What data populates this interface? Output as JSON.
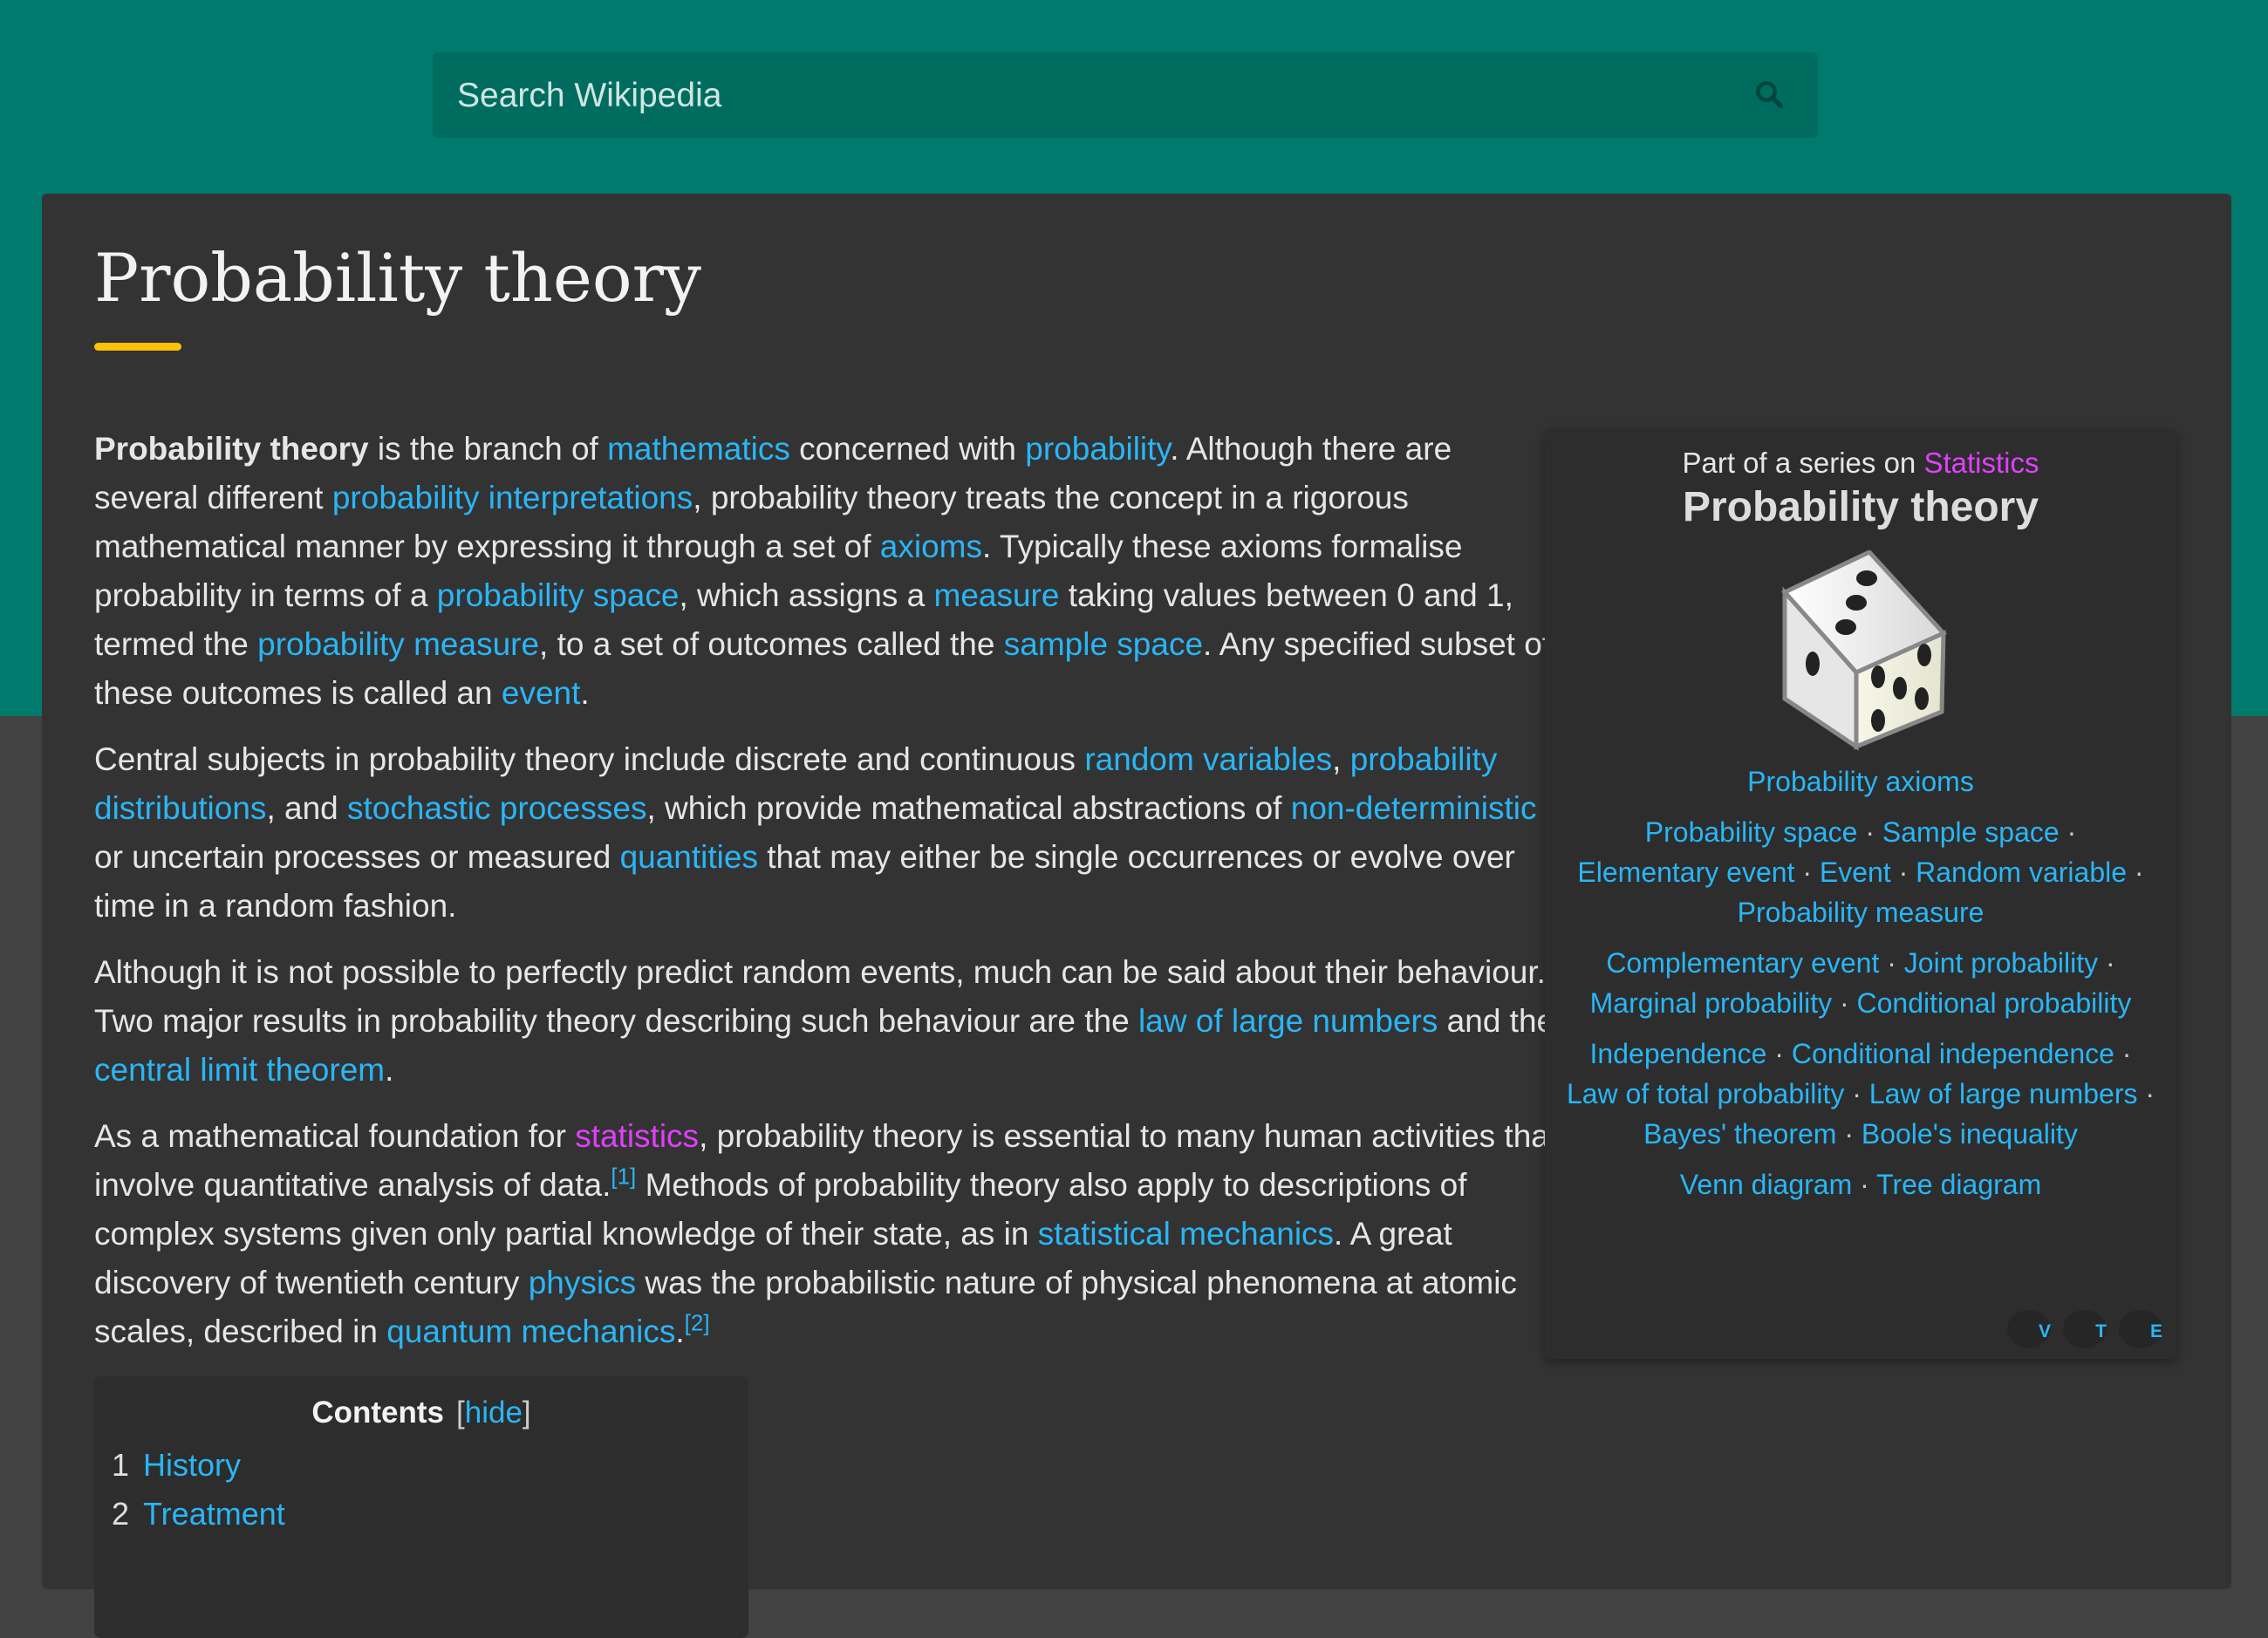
{
  "search": {
    "placeholder": "Search Wikipedia",
    "icon": "search-icon"
  },
  "article": {
    "title": "Probability theory",
    "accent_color": "#ffc107",
    "paragraphs": [
      [
        {
          "t": "Probability theory",
          "b": true
        },
        {
          "t": " is the branch of "
        },
        {
          "t": "mathematics",
          "l": 1
        },
        {
          "t": " concerned with "
        },
        {
          "t": "probability",
          "l": 1
        },
        {
          "t": ". Although there are several different "
        },
        {
          "t": "probability interpretations",
          "l": 1
        },
        {
          "t": ", probability theory treats the concept in a rigorous mathematical manner by expressing it through a set of "
        },
        {
          "t": "axioms",
          "l": 1
        },
        {
          "t": ". Typically these axioms formalise probability in terms of a "
        },
        {
          "t": "probability space",
          "l": 1
        },
        {
          "t": ", which assigns a "
        },
        {
          "t": "measure",
          "l": 1
        },
        {
          "t": " taking values between 0 and 1, termed the "
        },
        {
          "t": "probability measure",
          "l": 1
        },
        {
          "t": ", to a set of outcomes called the "
        },
        {
          "t": "sample space",
          "l": 1
        },
        {
          "t": ". Any specified subset of these outcomes is called an "
        },
        {
          "t": "event",
          "l": 1
        },
        {
          "t": "."
        }
      ],
      [
        {
          "t": "Central subjects in probability theory include discrete and continuous "
        },
        {
          "t": "random variables",
          "l": 1
        },
        {
          "t": ", "
        },
        {
          "t": "probability distributions",
          "l": 1
        },
        {
          "t": ", and "
        },
        {
          "t": "stochastic processes",
          "l": 1
        },
        {
          "t": ", which provide mathematical abstractions of "
        },
        {
          "t": "non-deterministic",
          "l": 1
        },
        {
          "t": " or uncertain processes or measured "
        },
        {
          "t": "quantities",
          "l": 1
        },
        {
          "t": " that may either be single occurrences or evolve over time in a random fashion."
        }
      ],
      [
        {
          "t": "Although it is not possible to perfectly predict random events, much can be said about their behaviour. Two major results in probability theory describing such behaviour are the "
        },
        {
          "t": "law of large numbers",
          "l": 1
        },
        {
          "t": " and the "
        },
        {
          "t": "central limit theorem",
          "l": 1
        },
        {
          "t": "."
        }
      ],
      [
        {
          "t": "As a mathematical foundation for "
        },
        {
          "t": "statistics",
          "l": 2
        },
        {
          "t": ", probability theory is essential to many human activities that involve quantitative analysis of data."
        },
        {
          "t": "[1]",
          "sup": true
        },
        {
          "t": " Methods of probability theory also apply to descriptions of complex systems given only partial knowledge of their state, as in "
        },
        {
          "t": "statistical mechanics",
          "l": 1
        },
        {
          "t": ". A great discovery of twentieth century "
        },
        {
          "t": "physics",
          "l": 1
        },
        {
          "t": " was the probabilistic nature of physical phenomena at atomic scales, described in "
        },
        {
          "t": "quantum mechanics",
          "l": 1
        },
        {
          "t": "."
        },
        {
          "t": "[2]",
          "sup": true
        }
      ]
    ]
  },
  "infobox": {
    "above_prefix": "Part of a series on",
    "above_link": "Statistics",
    "title": "Probability theory",
    "image": "dice-icon",
    "groups": [
      [
        "Probability axioms"
      ],
      [
        "Probability space",
        "Sample space",
        "Elementary event",
        "Event",
        "Random variable",
        "Probability measure"
      ],
      [
        "Complementary event",
        "Joint probability",
        "Marginal probability",
        "Conditional probability"
      ],
      [
        "Independence",
        "Conditional independence",
        "Law of total probability",
        "Law of large numbers",
        "Bayes' theorem",
        "Boole's inequality"
      ],
      [
        "Venn diagram",
        "Tree diagram"
      ]
    ],
    "vte": [
      "V",
      "T",
      "E"
    ]
  },
  "toc": {
    "title": "Contents",
    "toggle": "hide",
    "items": [
      {
        "num": "1",
        "label": "History"
      },
      {
        "num": "2",
        "label": "Treatment"
      }
    ]
  },
  "colors": {
    "header": "#007a6c",
    "link": "#29b6f6",
    "series_link": "#e040fb",
    "card": "#333333"
  }
}
